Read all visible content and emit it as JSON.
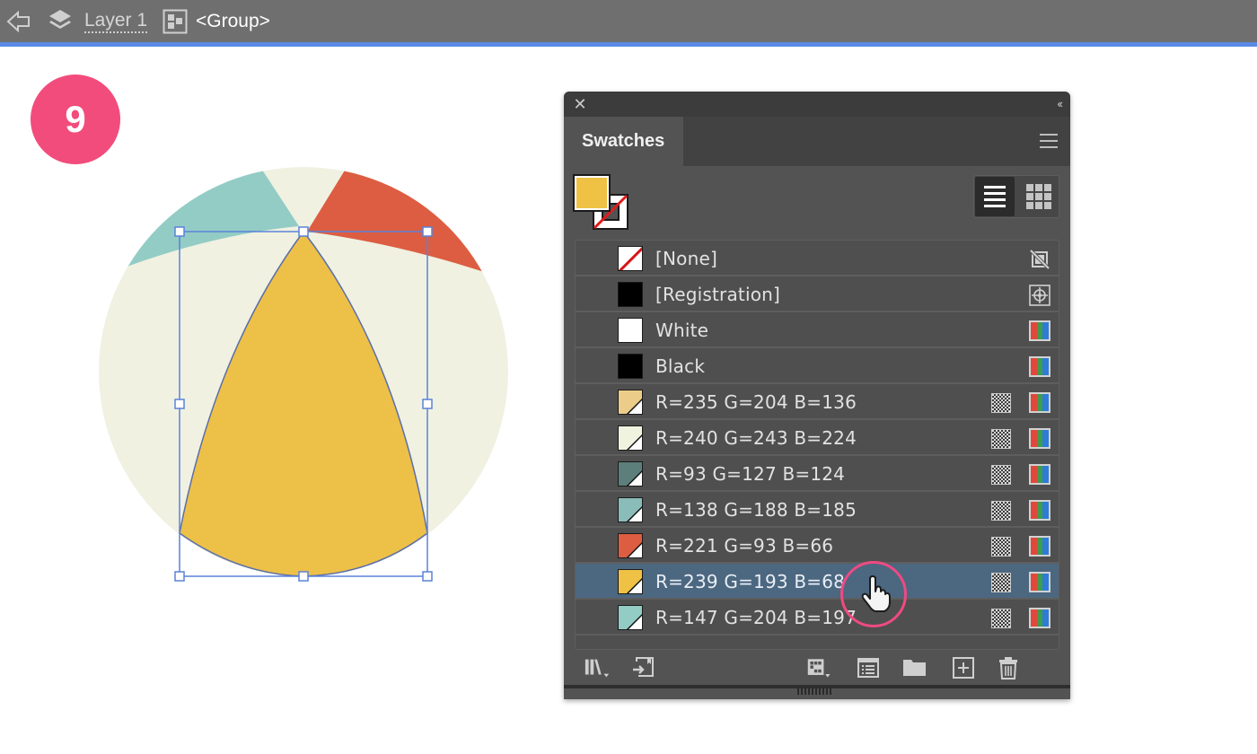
{
  "breadcrumb": {
    "back_icon": "back-arrow-icon",
    "layer_icon": "layers-icon",
    "layer_label": "Layer 1",
    "group_icon": "group-icon",
    "group_label": "<Group>"
  },
  "step_badge": "9",
  "artwork": {
    "description": "Beach ball illustration with selected yellow segment",
    "colors": {
      "ball_base": "#F0F3E0",
      "teal_segment": "#93CCC5",
      "red_segment": "#DD5D42",
      "yellow_segment": "#EFC144",
      "selection_bbox": "#5B82D9"
    }
  },
  "panel": {
    "close_icon": "close-icon",
    "collapse_icon": "collapse-double-chevron-icon",
    "tab_label": "Swatches",
    "menu_icon": "hamburger-menu-icon",
    "fill_color": "#EFC144",
    "stroke": "none",
    "view_modes": [
      {
        "name": "list-view",
        "active": true
      },
      {
        "name": "grid-view",
        "active": false
      }
    ],
    "swatches": [
      {
        "label": "[None]",
        "color": null,
        "type": "none",
        "icons": [
          "no-edit-icon"
        ],
        "selected": false
      },
      {
        "label": "[Registration]",
        "color": "#000000",
        "type": "registration",
        "icons": [
          "registration-icon"
        ],
        "selected": false
      },
      {
        "label": "White",
        "color": "#FFFFFF",
        "type": "process",
        "icons": [
          "rgb-mode-icon"
        ],
        "selected": false
      },
      {
        "label": "Black",
        "color": "#000000",
        "type": "process",
        "icons": [
          "rgb-mode-icon"
        ],
        "selected": false
      },
      {
        "label": "R=235 G=204 B=136",
        "color": "#EBCC88",
        "type": "global",
        "icons": [
          "global-checker-icon",
          "rgb-mode-icon"
        ],
        "selected": false
      },
      {
        "label": "R=240 G=243 B=224",
        "color": "#F0F3E0",
        "type": "global",
        "icons": [
          "global-checker-icon",
          "rgb-mode-icon"
        ],
        "selected": false
      },
      {
        "label": "R=93 G=127 B=124",
        "color": "#5D7F7C",
        "type": "global",
        "icons": [
          "global-checker-icon",
          "rgb-mode-icon"
        ],
        "selected": false
      },
      {
        "label": "R=138 G=188 B=185",
        "color": "#8ABCB9",
        "type": "global",
        "icons": [
          "global-checker-icon",
          "rgb-mode-icon"
        ],
        "selected": false
      },
      {
        "label": "R=221 G=93 B=66",
        "color": "#DD5D42",
        "type": "global",
        "icons": [
          "global-checker-icon",
          "rgb-mode-icon"
        ],
        "selected": false
      },
      {
        "label": "R=239 G=193 B=68",
        "color": "#EFC144",
        "type": "global",
        "icons": [
          "global-checker-icon",
          "rgb-mode-icon"
        ],
        "selected": true
      },
      {
        "label": "R=147 G=204 B=197",
        "color": "#93CCC5",
        "type": "global",
        "icons": [
          "global-checker-icon",
          "rgb-mode-icon"
        ],
        "selected": false
      }
    ],
    "bottom_buttons": [
      {
        "name": "swatch-libraries-menu-button",
        "icon": "library-icon"
      },
      {
        "name": "add-to-library-button",
        "icon": "import-icon"
      },
      {
        "name": "show-swatch-kinds-button",
        "icon": "swatch-kinds-icon"
      },
      {
        "name": "swatch-options-button",
        "icon": "list-options-icon"
      },
      {
        "name": "new-color-group-button",
        "icon": "folder-icon"
      },
      {
        "name": "new-swatch-button",
        "icon": "plus-square-icon"
      },
      {
        "name": "delete-swatch-button",
        "icon": "trash-icon"
      }
    ]
  },
  "cursor": {
    "type": "pointing-hand",
    "highlight_color": "#EE4A83"
  }
}
